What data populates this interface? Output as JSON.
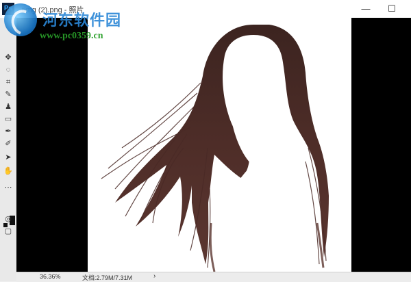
{
  "window": {
    "app_logo": "Ps",
    "title": "timg (2).png - 照片",
    "minimize_glyph": "—",
    "maximize_glyph": "☐"
  },
  "watermark": {
    "name": "河东软件园",
    "url": "www.pc0359.cn"
  },
  "toolbar": {
    "tools": [
      {
        "name": "move-icon",
        "glyph": "✥"
      },
      {
        "name": "lasso-icon",
        "glyph": "◌"
      },
      {
        "name": "crop-icon",
        "glyph": "⌗"
      },
      {
        "name": "eyedropper-icon",
        "glyph": "✎"
      },
      {
        "name": "stamp-icon",
        "glyph": "♟"
      },
      {
        "name": "eraser-icon",
        "glyph": "▭"
      },
      {
        "name": "brush-icon",
        "glyph": "✒"
      },
      {
        "name": "pen-icon",
        "glyph": "✐"
      },
      {
        "name": "select-arrow-icon",
        "glyph": "➤"
      },
      {
        "name": "hand-icon",
        "glyph": "✋"
      },
      {
        "name": "more-icon",
        "glyph": "⋯"
      },
      {
        "name": "quickmask-icon",
        "glyph": "◎"
      },
      {
        "name": "screenmode-icon",
        "glyph": "▢"
      }
    ]
  },
  "status": {
    "zoom": "36.36%",
    "doc": "文档:2.79M/7.31M",
    "arrow": "›"
  },
  "colors": {
    "canvas_bg": "#000000",
    "hair": "#4a2a26"
  }
}
